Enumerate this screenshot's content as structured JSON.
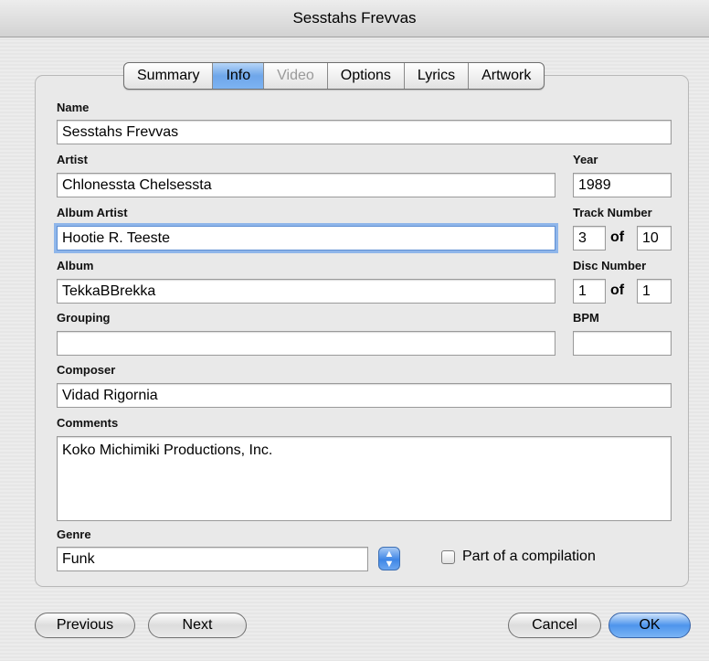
{
  "window": {
    "title": "Sesstahs Frevvas"
  },
  "tabs": [
    {
      "label": "Summary",
      "state": "normal"
    },
    {
      "label": "Info",
      "state": "active"
    },
    {
      "label": "Video",
      "state": "disabled"
    },
    {
      "label": "Options",
      "state": "normal"
    },
    {
      "label": "Lyrics",
      "state": "normal"
    },
    {
      "label": "Artwork",
      "state": "normal"
    }
  ],
  "fields": {
    "name": {
      "label": "Name",
      "value": "Sesstahs Frevvas"
    },
    "artist": {
      "label": "Artist",
      "value": "Chlonessta Chelsessta"
    },
    "year": {
      "label": "Year",
      "value": "1989"
    },
    "album_artist": {
      "label": "Album Artist",
      "value": "Hootie R. Teeste"
    },
    "track_number": {
      "label": "Track Number",
      "value": "3",
      "of_label": "of",
      "total": "10"
    },
    "album": {
      "label": "Album",
      "value": "TekkaBBrekka"
    },
    "disc_number": {
      "label": "Disc Number",
      "value": "1",
      "of_label": "of",
      "total": "1"
    },
    "grouping": {
      "label": "Grouping",
      "value": ""
    },
    "bpm": {
      "label": "BPM",
      "value": ""
    },
    "composer": {
      "label": "Composer",
      "value": "Vidad Rigornia"
    },
    "comments": {
      "label": "Comments",
      "value": "Koko Michimiki Productions, Inc."
    },
    "genre": {
      "label": "Genre",
      "value": "Funk"
    }
  },
  "compilation": {
    "label": "Part of a compilation",
    "checked": false
  },
  "buttons": {
    "previous": "Previous",
    "next": "Next",
    "cancel": "Cancel",
    "ok": "OK"
  },
  "colors": {
    "accent": "#4e95ec",
    "focus_ring": "#8fb6ea"
  }
}
